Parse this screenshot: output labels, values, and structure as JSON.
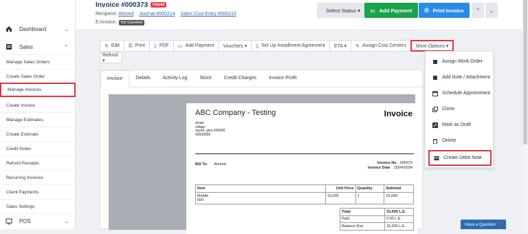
{
  "header": {
    "title": "Invoice #000373",
    "status_badge": "Unpaid",
    "recipient_label": "Recipient:",
    "recipient_link": "Ahmed",
    "journal_link": "Journal #000214",
    "cost_entry_link": "Sales Cost Entry #000215",
    "einvoice_label": "E.Invoice:",
    "einvoice_badge": "Not Submitted",
    "select_status": "Select Status ▾",
    "add_payment": "Add Payment",
    "print_invoice": "Print Invoice"
  },
  "sidebar": {
    "dashboard": "Dashboard",
    "sales": "Sales",
    "pos": "POS",
    "items": [
      {
        "label": "Manage Sales Orders"
      },
      {
        "label": "Create Sales Order"
      },
      {
        "label": "Manage Invoices"
      },
      {
        "label": "Create Invoice"
      },
      {
        "label": "Manage Estimates"
      },
      {
        "label": "Create Estimate"
      },
      {
        "label": "Credit Notes"
      },
      {
        "label": "Refund Receipts"
      },
      {
        "label": "Recurring Invoices"
      },
      {
        "label": "Client Payments"
      },
      {
        "label": "Sales Settings"
      }
    ]
  },
  "toolbar": {
    "edit": "Edit",
    "print": "Print",
    "pdf": "PDF",
    "add_payment": "Add Payment",
    "vouchers": "Vouchers ▾",
    "installment": "Set Up Installment Agreement",
    "eta": "ETA ▾",
    "assign_cost": "Assign Cost Centers",
    "more_options": "More Options ▾",
    "refund": "Refund ▾"
  },
  "tabs": [
    "Invoice",
    "Details",
    "Activity Log",
    "Stock",
    "Credit Charges",
    "Invoice Profit"
  ],
  "invoice": {
    "company": "ABC Company - Testing",
    "heading": "Invoice",
    "address": [
      "smart",
      "village",
      "zayed, giza 000000",
      "00000000"
    ],
    "bill_to_label": "Bill To:",
    "bill_to_name": "Ahmed",
    "invoice_no_label": "Invoice No",
    "invoice_no": "000373",
    "invoice_date_label": "Invoice Date",
    "invoice_date": "15/04/2024",
    "columns": [
      "Item",
      "Unit Price",
      "Quantity",
      "Subtotal"
    ],
    "rows": [
      {
        "item": "Mobile",
        "desc": "500",
        "price": "15,000",
        "qty": "1",
        "subtotal": "15,000"
      }
    ],
    "total_label": "Total",
    "total": "15,000 L.E.",
    "paid_label": "Paid",
    "paid": "0.00 L.E.",
    "balance_label": "Balance Due",
    "balance": "15,000 L.E."
  },
  "more_options_menu": [
    {
      "label": "Assign Work Order",
      "icon": "book-icon"
    },
    {
      "label": "Add Note / Attachment",
      "icon": "note-icon"
    },
    {
      "label": "Schedule Appointment",
      "icon": "calendar-icon"
    },
    {
      "label": "Clone",
      "icon": "copy-icon"
    },
    {
      "label": "Mark as Draft",
      "icon": "edit-icon"
    },
    {
      "label": "Delete",
      "icon": "trash-icon"
    },
    {
      "label": "Create Debit Note",
      "icon": "debit-note-icon"
    }
  ],
  "help_button": "Have a Question ❓",
  "colors": {
    "accent_red": "#e0333b",
    "green": "#1aa34a",
    "blue": "#2b8ae6",
    "navy": "#1f3b63"
  }
}
